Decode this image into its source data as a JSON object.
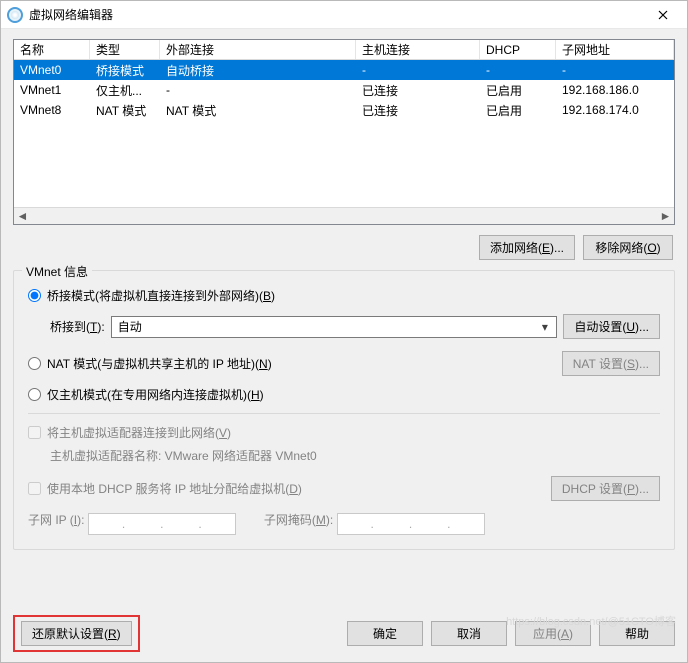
{
  "title": "虚拟网络编辑器",
  "close_symbol": "×",
  "table": {
    "headers": {
      "name": "名称",
      "type": "类型",
      "external": "外部连接",
      "host": "主机连接",
      "dhcp": "DHCP",
      "subnet": "子网地址"
    },
    "rows": [
      {
        "name": "VMnet0",
        "type": "桥接模式",
        "external": "自动桥接",
        "host": "-",
        "dhcp": "-",
        "subnet": "-"
      },
      {
        "name": "VMnet1",
        "type": "仅主机...",
        "external": "-",
        "host": "已连接",
        "dhcp": "已启用",
        "subnet": "192.168.186.0"
      },
      {
        "name": "VMnet8",
        "type": "NAT 模式",
        "external": "NAT 模式",
        "host": "已连接",
        "dhcp": "已启用",
        "subnet": "192.168.174.0"
      }
    ]
  },
  "buttons": {
    "add_net": {
      "text": "添加网络(",
      "accel": "E",
      "tail": ")..."
    },
    "remove_net": {
      "text": "移除网络(",
      "accel": "O",
      "tail": ")"
    },
    "auto_set": {
      "text": "自动设置(",
      "accel": "U",
      "tail": ")..."
    },
    "nat_set": {
      "text": "NAT 设置(",
      "accel": "S",
      "tail": ")..."
    },
    "dhcp_set": {
      "text": "DHCP 设置(",
      "accel": "P",
      "tail": ")..."
    },
    "restore": {
      "text": "还原默认设置(",
      "accel": "R",
      "tail": ")"
    },
    "ok": "确定",
    "cancel": "取消",
    "apply": {
      "text": "应用(",
      "accel": "A",
      "tail": ")"
    },
    "help": "帮助"
  },
  "group": {
    "title": "VMnet 信息",
    "r_bridge": {
      "text": "桥接模式(将虚拟机直接连接到外部网络)(",
      "accel": "B",
      "tail": ")"
    },
    "bridge_to_label": {
      "text": "桥接到(",
      "accel": "T",
      "tail": "):"
    },
    "bridge_to_value": "自动",
    "r_nat": {
      "text": "NAT 模式(与虚拟机共享主机的 IP 地址)(",
      "accel": "N",
      "tail": ")"
    },
    "r_host": {
      "text": "仅主机模式(在专用网络内连接虚拟机)(",
      "accel": "H",
      "tail": ")"
    },
    "c_host_adapter": {
      "text": "将主机虚拟适配器连接到此网络(",
      "accel": "V",
      "tail": ")"
    },
    "adapter_name_label": "主机虚拟适配器名称: ",
    "adapter_name_value": "VMware 网络适配器 VMnet0",
    "c_dhcp": {
      "text": "使用本地 DHCP 服务将 IP 地址分配给虚拟机(",
      "accel": "D",
      "tail": ")"
    },
    "sub_ip": {
      "text": "子网 IP (",
      "accel": "I",
      "tail": "):"
    },
    "sub_mask": {
      "text": "子网掩码(",
      "accel": "M",
      "tail": "):"
    }
  },
  "watermark": "https://blog.csdn.net/@51CTO博客"
}
